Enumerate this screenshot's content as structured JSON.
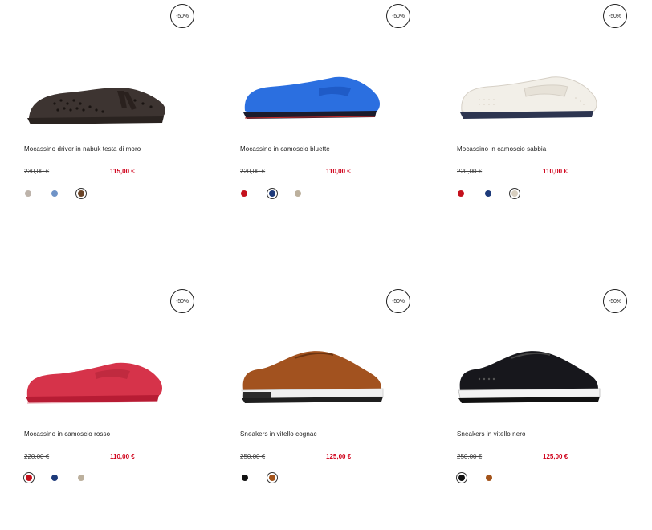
{
  "colors": {
    "sale_red": "#d0021b"
  },
  "products": [
    {
      "badge": "-50%",
      "title": "Mocassino driver in nabuk testa di moro",
      "old_price": "230,00 €",
      "new_price": "115,00 €",
      "image": "brown-perforated-driver-loafer",
      "swatches": [
        {
          "color": "#bdb3aa",
          "selected": false
        },
        {
          "color": "#6f93c7",
          "selected": false
        },
        {
          "color": "#6a4326",
          "selected": true
        }
      ]
    },
    {
      "badge": "-50%",
      "title": "Mocassino in camoscio bluette",
      "old_price": "220,00 €",
      "new_price": "110,00 €",
      "image": "blue-suede-loafer",
      "swatches": [
        {
          "color": "#c4101c",
          "selected": false
        },
        {
          "color": "#1d3a7a",
          "selected": true
        },
        {
          "color": "#bcb09d",
          "selected": false
        }
      ]
    },
    {
      "badge": "-50%",
      "title": "Mocassino in camoscio sabbia",
      "old_price": "220,00 €",
      "new_price": "110,00 €",
      "image": "white-perforated-loafer",
      "swatches": [
        {
          "color": "#c4101c",
          "selected": false
        },
        {
          "color": "#1d3a7a",
          "selected": false
        },
        {
          "color": "#d8cfc0",
          "selected": true
        }
      ]
    },
    {
      "badge": "-50%",
      "title": "Mocassino in camoscio rosso",
      "old_price": "220,00 €",
      "new_price": "110,00 €",
      "image": "red-suede-loafer",
      "swatches": [
        {
          "color": "#c4101c",
          "selected": true
        },
        {
          "color": "#1d3a7a",
          "selected": false
        },
        {
          "color": "#bcb09d",
          "selected": false
        }
      ]
    },
    {
      "badge": "-50%",
      "title": "Sneakers in vitello cognac",
      "old_price": "250,00 €",
      "new_price": "125,00 €",
      "image": "cognac-leather-sneaker",
      "swatches": [
        {
          "color": "#111111",
          "selected": false
        },
        {
          "color": "#a3531a",
          "selected": true
        }
      ]
    },
    {
      "badge": "-50%",
      "title": "Sneakers in vitello nero",
      "old_price": "250,00 €",
      "new_price": "125,00 €",
      "image": "black-leather-sneaker",
      "swatches": [
        {
          "color": "#111111",
          "selected": true
        },
        {
          "color": "#a3531a",
          "selected": false
        }
      ]
    }
  ]
}
